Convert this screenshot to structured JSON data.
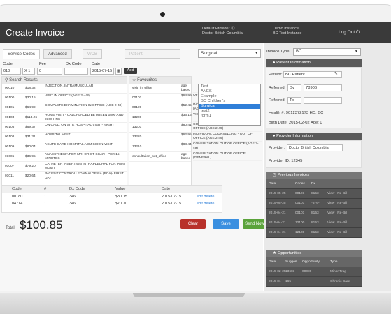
{
  "header": {
    "title": "Create Invoice",
    "provider_line1": "Default Provider ⓘ",
    "provider_line2": "Doctor British Columbia",
    "instance_line1": "Demo Instance",
    "instance_line2": "BC Test Instance",
    "logout_label": "Log Out",
    "logout_icon": "power-icon"
  },
  "tabs": [
    {
      "label": "Service Codes"
    },
    {
      "label": "Advanced"
    },
    {
      "label": "WCB"
    },
    {
      "label": "Patient"
    }
  ],
  "code_list_select": {
    "value": "Surgical",
    "options": [
      "Test",
      "ANES",
      "Example",
      "BC Children's",
      "Surgical",
      "test2",
      "form1"
    ],
    "selected_index": 4
  },
  "entry": {
    "code_label": "Code",
    "code_value": "010",
    "fee_label": "Fee",
    "fee_value": "0",
    "multiplier": "X 1",
    "dx_label": "Dx Code",
    "date_label": "Date",
    "date_value": "2015-07-15",
    "add_label": "Add"
  },
  "search_results": {
    "title": "Search Results",
    "rows": [
      {
        "code": "00010",
        "fee": "$18.32",
        "desc": "INJECTION, INTRAMUSCULAR"
      },
      {
        "code": "00100",
        "fee": "$30.15",
        "desc": "VISIT IN OFFICE (AGE 2 - 49)"
      },
      {
        "code": "00101",
        "fee": "$64.99",
        "desc": "COMPLETE EXAMINATION IN OFFICE (AGE 2-49)"
      },
      {
        "code": "00103",
        "fee": "$113.26",
        "desc": "HOME VISIT - CALL PLACED BETWEEN 0800 AND 2300 HRS"
      },
      {
        "code": "00105",
        "fee": "$69.37",
        "desc": "ON CALL, ON SITE HOSPITAL VISIT - NIGHT"
      },
      {
        "code": "00108",
        "fee": "$31.31",
        "desc": "HOSPITAL VISIT"
      },
      {
        "code": "00109",
        "fee": "$80.04",
        "desc": "ACUTE CARE HOSPITAL ADMISSION VISIT"
      },
      {
        "code": "01005",
        "fee": "$36.95",
        "desc": "ANAESTHESIA FOR MRI OR CT SCAN - PER 15 MINUTES"
      },
      {
        "code": "01007",
        "fee": "$79.20",
        "desc": "CATHETER INSERTION INTRAPLEURAL FOR PAIN MGMT"
      },
      {
        "code": "01011",
        "fee": "$20.64",
        "desc": "PATIENT CONTROLLED ANALGESIA (PCA)- FIRST DAY"
      }
    ]
  },
  "favourites": {
    "title": "Favourites",
    "rows": [
      {
        "name": "visit_in_office",
        "fee": "age based"
      },
      {
        "code": "00101",
        "fee": "$64.99"
      },
      {
        "code": "00120",
        "fee": "$52.45"
      },
      {
        "code": "13200",
        "fee": "$36.16"
      },
      {
        "code": "13201",
        "fee": "$80.41"
      },
      {
        "code": "13220",
        "fee": "$62.95"
      },
      {
        "code": "13210",
        "fee": "$88.44"
      },
      {
        "name": "consultation_out_office",
        "fee": "age based"
      }
    ],
    "descriptions": [
      "",
      "OFFICE (AGE 2-49)",
      "INDIVIDUAL COUNSELLING IN OFFICE (AGE 2-49)",
      "VISIT - OUT OF OFFICE (AGE 2-49)",
      "COMPLETE EXAMINATION - OUT OF OFFICE (AGE 2-49)",
      "INDIVIDUAL COUNSELLING - OUT OF OFFICE (AGE 2-49)",
      "CONSULTATION OUT OF OFFICE (AGE 2-49)",
      "CONSULTATION OUT OF OFFICE (GENERAL)"
    ]
  },
  "selected_items": {
    "headers": [
      "Code",
      "#",
      "Dx Code",
      "Value",
      "Date",
      ""
    ],
    "rows": [
      {
        "code": "00180",
        "num": "1",
        "dx": "346",
        "value": "$30.15",
        "date": "2015-07-15",
        "action": "edit delete"
      },
      {
        "code": "04714",
        "num": "1",
        "dx": "346",
        "value": "$70.70",
        "date": "2015-07-15",
        "action": "edit delete"
      }
    ]
  },
  "total": {
    "label": "Total",
    "value": "$100.85"
  },
  "buttons": {
    "clear": "Clear",
    "save": "Save",
    "send": "Send Now"
  },
  "right_panel": {
    "invoice_type_label": "Invoice Type:",
    "invoice_type_value": "BC",
    "patient": {
      "title": "Patient Information",
      "patient_label": "Patient:",
      "patient_value": "BC Patient",
      "referred_by_label": "Referred:",
      "referred_by_type": "By",
      "referred_by_value": "78906",
      "referred_to_label": "Referred:",
      "referred_to_type": "To",
      "health_line": "Health #: 9012372173   HC: BC",
      "birth_line": "Birth Date: 2015-02-02   Age: 0"
    },
    "provider": {
      "title": "Provider Information",
      "provider_label": "Provider:",
      "provider_value": "Doctor British Columbia",
      "provider_id": "Provider ID: 12345"
    },
    "previous_invoices": {
      "title": "Previous Invoices",
      "headers": [
        "Date",
        "Codes",
        "Dx",
        ""
      ],
      "rows": [
        {
          "date": "2015-05-25",
          "codes": "00101",
          "dx": "8153",
          "link": "View | Re-Bill"
        },
        {
          "date": "2015-05-25",
          "codes": "00101",
          "dx": "*576-*",
          "link": "View | Re-Bill"
        },
        {
          "date": "2015-04-21",
          "codes": "00101",
          "dx": "8153",
          "link": "View | Re-Bill"
        },
        {
          "date": "2015-04-21",
          "codes": "12100",
          "dx": "8153",
          "link": "View | Re-Bill"
        },
        {
          "date": "2015-04-21",
          "codes": "12100",
          "dx": "8153",
          "link": "View | Re-Bill"
        }
      ]
    },
    "opportunities": {
      "title": "Opportunities",
      "headers": [
        "Date",
        "Sugges",
        "Opportunity",
        "Type"
      ],
      "rows": [
        {
          "date": "2015-02-25",
          "sugg": "13603",
          "opp": "00080",
          "type": "Minor Trag"
        },
        {
          "date": "2015-01-",
          "sugg": "165",
          "opp": "",
          "type": "Chronic Care"
        }
      ]
    }
  }
}
